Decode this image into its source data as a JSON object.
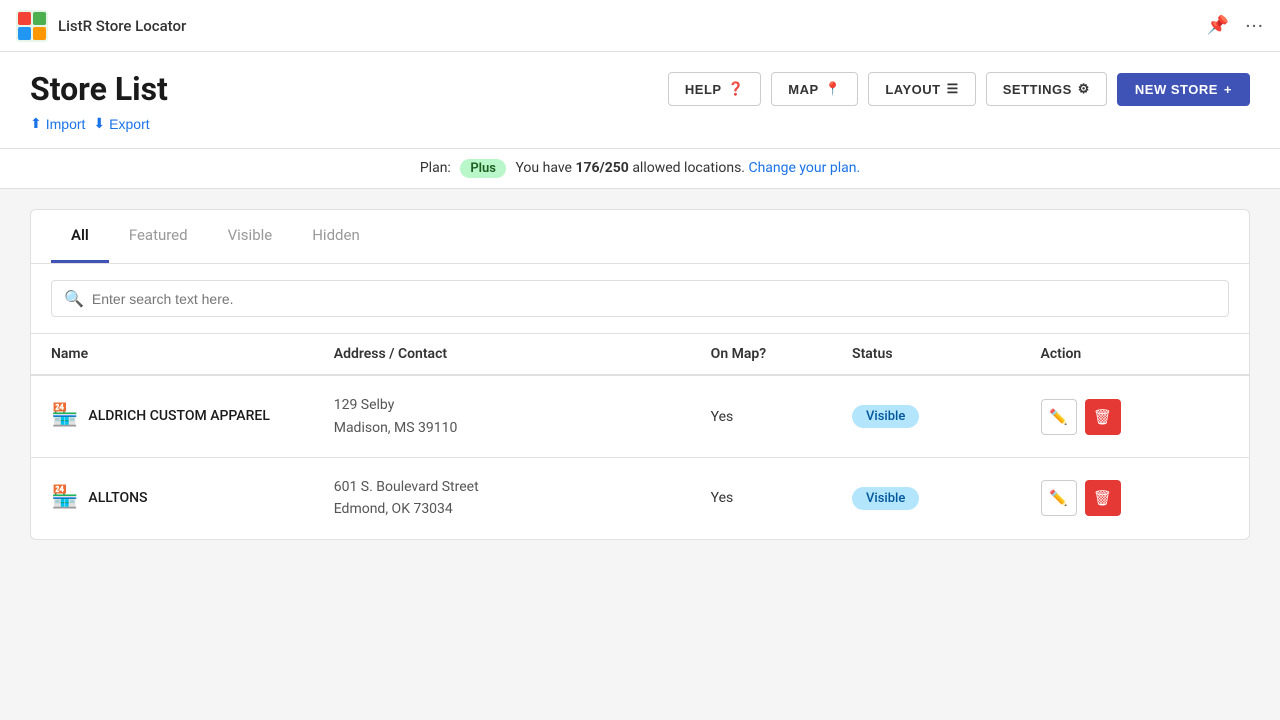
{
  "app": {
    "title": "ListR Store Locator",
    "logo_alt": "ListR logo"
  },
  "topbar": {
    "pin_icon": "📌",
    "ellipsis": "···"
  },
  "header": {
    "title": "Store List",
    "import_label": "Import",
    "export_label": "Export",
    "buttons": [
      {
        "id": "help",
        "label": "HELP",
        "icon": "❓"
      },
      {
        "id": "map",
        "label": "MAP",
        "icon": "📍"
      },
      {
        "id": "layout",
        "label": "LAYOUT",
        "icon": "☰"
      },
      {
        "id": "settings",
        "label": "SETTINGS",
        "icon": "⚙"
      }
    ],
    "new_store_label": "NEW STORE",
    "new_store_icon": "+"
  },
  "plan": {
    "label": "Plan:",
    "badge": "Plus",
    "description": "You have",
    "current": "176/250",
    "suffix": "allowed locations.",
    "link_text": "Change your plan."
  },
  "tabs": [
    {
      "id": "all",
      "label": "All",
      "active": true
    },
    {
      "id": "featured",
      "label": "Featured",
      "active": false
    },
    {
      "id": "visible",
      "label": "Visible",
      "active": false
    },
    {
      "id": "hidden",
      "label": "Hidden",
      "active": false
    }
  ],
  "search": {
    "placeholder": "Enter search text here."
  },
  "table": {
    "columns": [
      {
        "id": "name",
        "label": "Name"
      },
      {
        "id": "address",
        "label": "Address / Contact"
      },
      {
        "id": "onmap",
        "label": "On Map?"
      },
      {
        "id": "status",
        "label": "Status"
      },
      {
        "id": "action",
        "label": "Action"
      }
    ],
    "rows": [
      {
        "id": 1,
        "name": "ALDRICH CUSTOM APPAREL",
        "address_line1": "129 Selby",
        "address_line2": "Madison, MS 39110",
        "on_map": "Yes",
        "status": "Visible"
      },
      {
        "id": 2,
        "name": "ALLTONS",
        "address_line1": "601 S. Boulevard Street",
        "address_line2": "Edmond, OK 73034",
        "on_map": "Yes",
        "status": "Visible"
      }
    ]
  }
}
